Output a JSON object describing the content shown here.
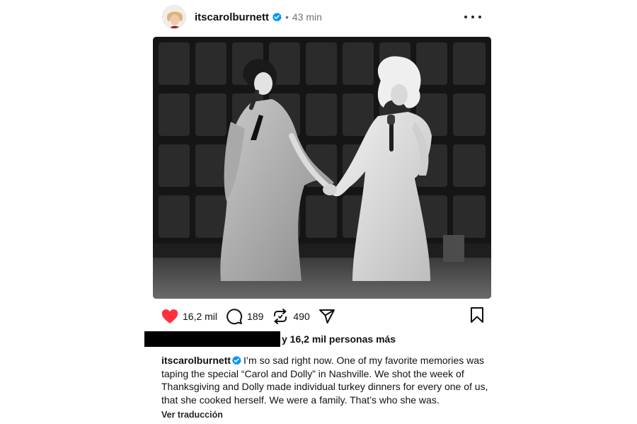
{
  "post": {
    "username": "itscarolburnett",
    "separator": "•",
    "time": "43 min",
    "verified": true
  },
  "actions": {
    "likes": "16,2 mil",
    "comments": "189",
    "reposts": "490"
  },
  "liked_by": {
    "suffix": "y 16,2 mil personas más"
  },
  "caption": {
    "username": "itscarolburnett",
    "text": "I’m so sad right now. One of my favorite memories was taping the special “Carol and Dolly” in Nashville. We shot the week of Thanksgiving and Dolly made individual turkey dinners for every one of us, that she cooked herself. We were a family. That’s who she was."
  },
  "see_translation": "Ver traducción",
  "colors": {
    "like_red": "#ff3040",
    "verified_blue": "#0095f6",
    "muted": "#737373"
  },
  "icons": [
    "more-icon",
    "heart-icon",
    "comment-icon",
    "repost-icon",
    "share-icon",
    "bookmark-icon",
    "verified-icon"
  ]
}
